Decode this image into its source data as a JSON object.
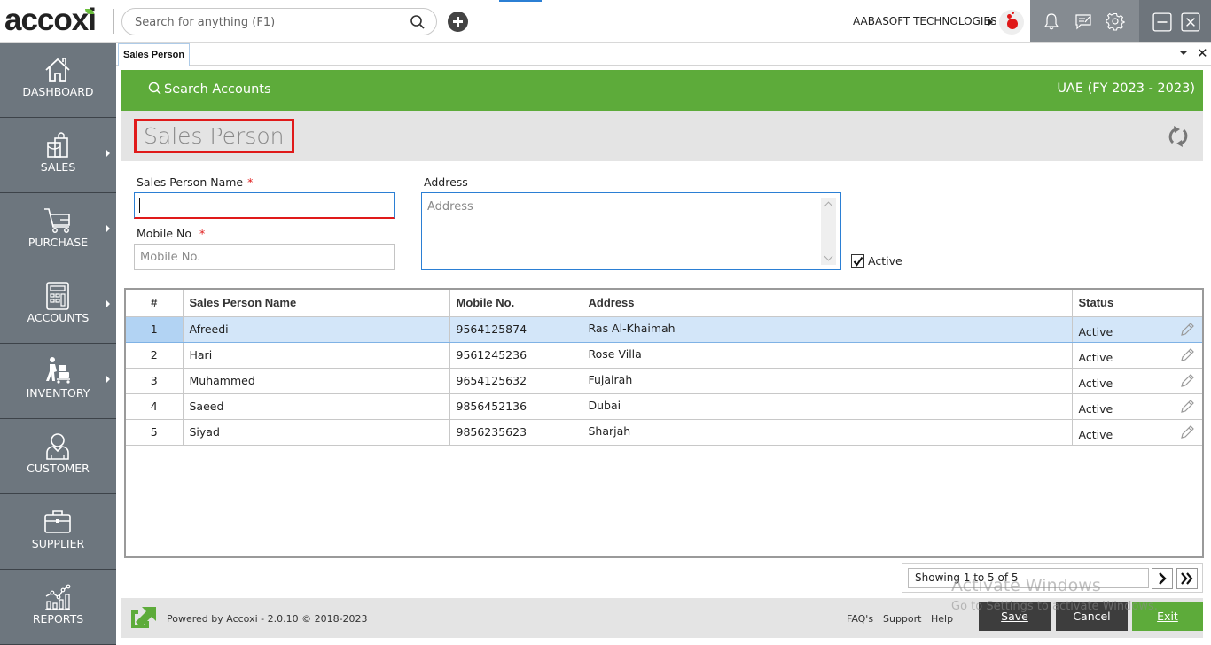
{
  "topbar": {
    "logo": "accoxi",
    "search_placeholder": "Search for anything (F1)",
    "company": "AABASOFT TECHNOLOGIES",
    "icons": [
      "search-icon",
      "add-icon",
      "bell-icon",
      "message-icon",
      "gear-icon",
      "minimize-icon",
      "close-icon"
    ]
  },
  "sidebar": {
    "items": [
      {
        "label": "DASHBOARD",
        "icon": "home-icon",
        "has_submenu": false
      },
      {
        "label": "SALES",
        "icon": "shopping-bag-icon",
        "has_submenu": true
      },
      {
        "label": "PURCHASE",
        "icon": "cart-icon",
        "has_submenu": true
      },
      {
        "label": "ACCOUNTS",
        "icon": "calculator-icon",
        "has_submenu": true
      },
      {
        "label": "INVENTORY",
        "icon": "worker-trolley-icon",
        "has_submenu": true
      },
      {
        "label": "CUSTOMER",
        "icon": "user-icon",
        "has_submenu": false
      },
      {
        "label": "SUPPLIER",
        "icon": "briefcase-icon",
        "has_submenu": false
      },
      {
        "label": "REPORTS",
        "icon": "chart-icon",
        "has_submenu": false
      }
    ]
  },
  "tabs": [
    {
      "label": "Sales Person",
      "active": true
    }
  ],
  "header": {
    "search_accounts": "Search Accounts",
    "fiscal_year": "UAE (FY 2023 - 2023)",
    "page_title": "Sales Person"
  },
  "form": {
    "name_label": "Sales Person Name",
    "name_value": "",
    "mobile_label": "Mobile No",
    "mobile_placeholder": "Mobile No.",
    "required_mark": "*",
    "address_label": "Address",
    "address_placeholder": "Address",
    "active_label": "Active",
    "active_checked": true
  },
  "table": {
    "columns": [
      "#",
      "Sales Person Name",
      "Mobile No.",
      "Address",
      "Status",
      ""
    ],
    "rows": [
      {
        "num": "1",
        "name": "Afreedi",
        "mobile": "9564125874",
        "address": "Ras Al-Khaimah",
        "status": "Active",
        "selected": true
      },
      {
        "num": "2",
        "name": "Hari",
        "mobile": "9561245236",
        "address": "Rose Villa",
        "status": "Active",
        "selected": false
      },
      {
        "num": "3",
        "name": "Muhammed",
        "mobile": "9654125632",
        "address": "Fujairah",
        "status": "Active",
        "selected": false
      },
      {
        "num": "4",
        "name": "Saeed",
        "mobile": "9856452136",
        "address": "Dubai",
        "status": "Active",
        "selected": false
      },
      {
        "num": "5",
        "name": "Siyad",
        "mobile": "9856235623",
        "address": "Sharjah",
        "status": "Active",
        "selected": false
      }
    ]
  },
  "pager": {
    "text": "Showing 1 to 5 of 5",
    "next": "›",
    "last": "»"
  },
  "footer": {
    "powered_by": "Powered by Accoxi - 2.0.10 © 2018-2023",
    "links": [
      "FAQ's",
      "Support",
      "Help"
    ],
    "save_label": "Save",
    "cancel_label": "Cancel",
    "exit_label": "Exit"
  },
  "watermark": {
    "line1": "Activate Windows",
    "line2": "Go to Settings to activate Windows."
  },
  "colors": {
    "brand_green": "#5dab3a",
    "sidebar": "#6d767e",
    "required": "#e01a1a",
    "selected_row": "#d3e6f9"
  }
}
